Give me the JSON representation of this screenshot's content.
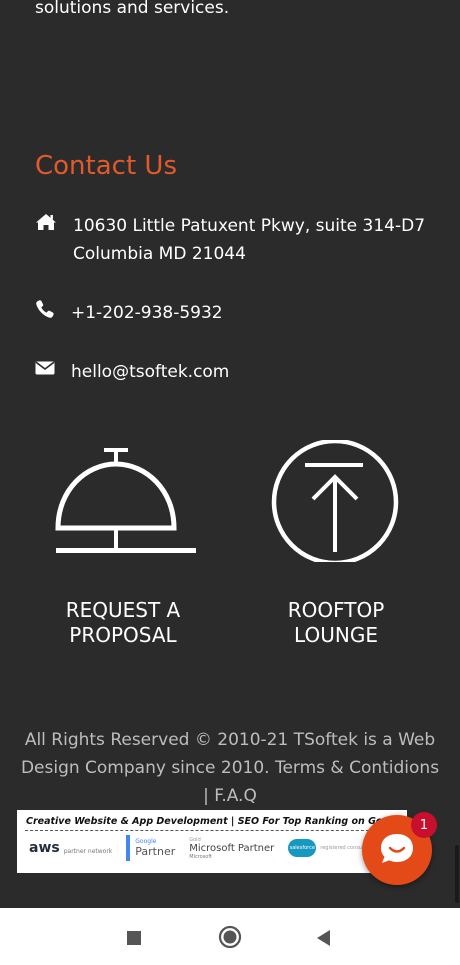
{
  "intro": {
    "tail_text": "solutions and services."
  },
  "contact": {
    "title": "Contact Us",
    "address": "10630 Little Patuxent Pkwy, suite 314-D7 Columbia MD 21044",
    "phone": "+1-202-938-5932",
    "email": "hello@tsoftek.com",
    "icons": [
      "home-icon",
      "phone-icon",
      "envelope-icon"
    ]
  },
  "promos": {
    "proposal_label_1": "REQUEST A",
    "proposal_label_2": "PROPOSAL",
    "rooftop_label_1": "ROOFTOP",
    "rooftop_label_2": "LOUNGE",
    "icons": [
      "service-bell-icon",
      "arrow-up-circle-icon"
    ]
  },
  "footer": {
    "copyright": "All Rights Reserved © 2010-21 TSoftek is a Web Design Company since 2010. Terms & Contidions | F.A.Q"
  },
  "partner_banner": {
    "headline": "Creative Website & App Development | SEO For Top Ranking on Google",
    "aws_word": "aws",
    "aws_sub": "partner network",
    "google_top": "Google",
    "google_main": "Partner",
    "ms_top": "Gold",
    "ms_main": "Microsoft Partner",
    "ms_bottom": "Microsoft",
    "sf_cloud": "salesforce",
    "sf_sub": "registered consulting partner"
  },
  "chat": {
    "badge_count": "1",
    "icon": "chat-bubble-icon"
  },
  "colors": {
    "accent": "#e05a2a",
    "chat": "#e44a18",
    "badge": "#c8102e",
    "background": "#2b2b2b"
  },
  "nav": {
    "icons": [
      "recents-square-icon",
      "home-circle-icon",
      "back-triangle-icon"
    ]
  }
}
